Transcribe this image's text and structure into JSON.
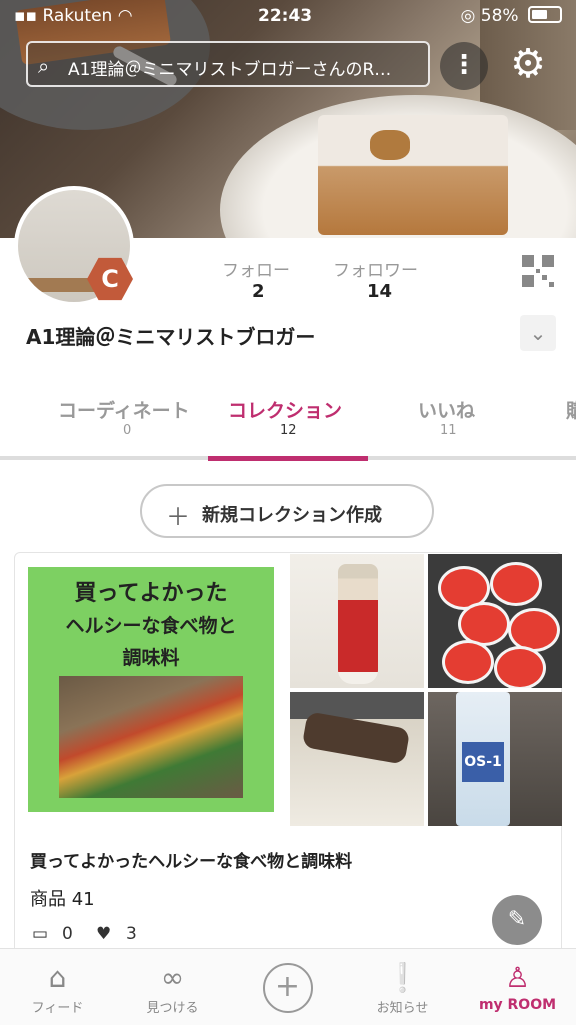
{
  "status_bar": {
    "carrier": "Rakuten",
    "time": "22:43",
    "battery": "58%"
  },
  "header": {
    "search_text": "A1理論＠ミニマリストブロガーさんのR…"
  },
  "profile": {
    "badge_letter": "C",
    "follow_label": "フォロー",
    "follow_count": "2",
    "follower_label": "フォロワー",
    "follower_count": "14",
    "username": "A1理論＠ミニマリストブロガー"
  },
  "tabs": [
    {
      "label": "コーディネート",
      "count": "0",
      "active": false
    },
    {
      "label": "コレクション",
      "count": "12",
      "active": true
    },
    {
      "label": "いいね",
      "count": "11",
      "active": false
    },
    {
      "label": "購",
      "count": "",
      "active": false
    }
  ],
  "new_collection_button": {
    "plus": "＋",
    "label": "新規コレクション作成"
  },
  "collection_card": {
    "cover_lines": [
      "買ってよかった",
      "ヘルシーな食べ物と",
      "調味料"
    ],
    "title": "買ってよかったヘルシーな食べ物と調味料",
    "item_count": "商品 41",
    "comments": "0",
    "likes": "3",
    "thumb4_label": "OS-1"
  },
  "bottom_nav": [
    {
      "label": "フィード",
      "icon": "home-icon",
      "active": false
    },
    {
      "label": "見つける",
      "icon": "binoculars-icon",
      "active": false
    },
    {
      "label": "",
      "icon": "add-circle-icon",
      "active": false
    },
    {
      "label": "お知らせ",
      "icon": "notice-icon",
      "active": false
    },
    {
      "label": "my ROOM",
      "icon": "person-icon",
      "active": true
    }
  ],
  "colors": {
    "accent": "#bf2e6f",
    "cover_green": "#7dd062"
  }
}
